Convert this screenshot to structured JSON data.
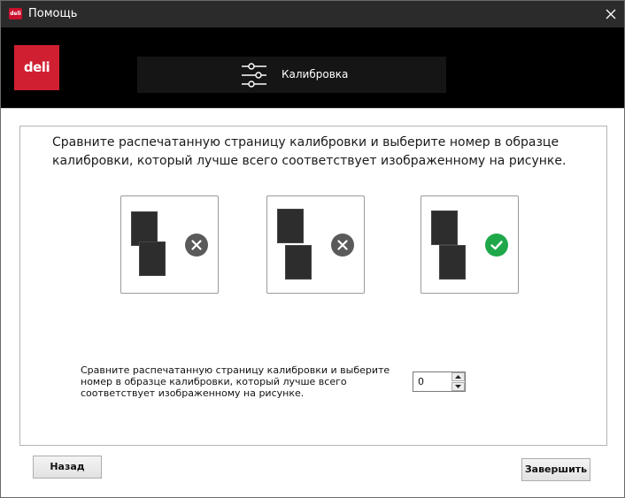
{
  "window": {
    "title": "Помощь",
    "app_icon": "deli-app-icon"
  },
  "header": {
    "logo_text": "deli",
    "tab_label": "Калибровка",
    "tab_icon": "sliders-icon"
  },
  "main": {
    "instruction": "Сравните распечатанную страницу калибровки и выберите номер в образце калибровки, который лучше всего соответствует изображенному на рисунке.",
    "samples": [
      {
        "status": "incorrect",
        "icon": "x-circle-icon",
        "color": "#5a5a5a"
      },
      {
        "status": "incorrect",
        "icon": "x-circle-icon",
        "color": "#5a5a5a"
      },
      {
        "status": "correct",
        "icon": "check-circle-icon",
        "color": "#1fa84a"
      }
    ],
    "field_label": "Сравните распечатанную страницу калибровки и выберите номер в образце калибровки, который лучше всего соответствует изображенному на рисунке.",
    "number_value": "0"
  },
  "buttons": {
    "back": "Назад",
    "finish": "Завершить"
  },
  "colors": {
    "brand_red": "#d01f31",
    "titlebar": "#2b2b2b",
    "header": "#000000"
  }
}
